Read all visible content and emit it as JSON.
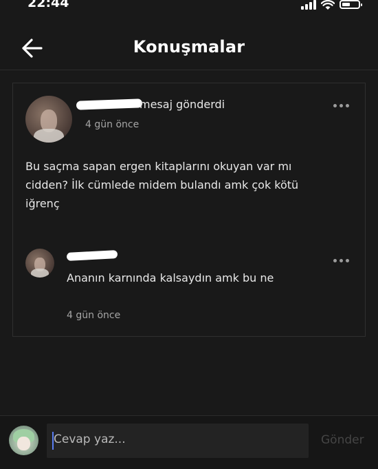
{
  "status_bar": {
    "time": "22:44",
    "icons": [
      "signal-icon",
      "wifi-icon",
      "battery-icon"
    ]
  },
  "header": {
    "back_icon": "arrow-left-icon",
    "title": "Konuşmalar"
  },
  "thread": {
    "action_text": "mesaj gönderdi",
    "time": "4 gün önce",
    "message": "Bu saçma sapan ergen kitaplarını okuyan var mı cidden? İlk cümlede midem bulandı amk çok kötü iğrenç",
    "reply": {
      "message": "Ananın karnında kalsaydın amk bu ne",
      "time": "4 gün önce"
    }
  },
  "composer": {
    "placeholder": "Cevap yaz...",
    "send_label": "Gönder"
  },
  "colors": {
    "background": "#191919",
    "text": "#e6e6e6",
    "muted": "#a6a6a6",
    "caret": "#5a7df2"
  }
}
